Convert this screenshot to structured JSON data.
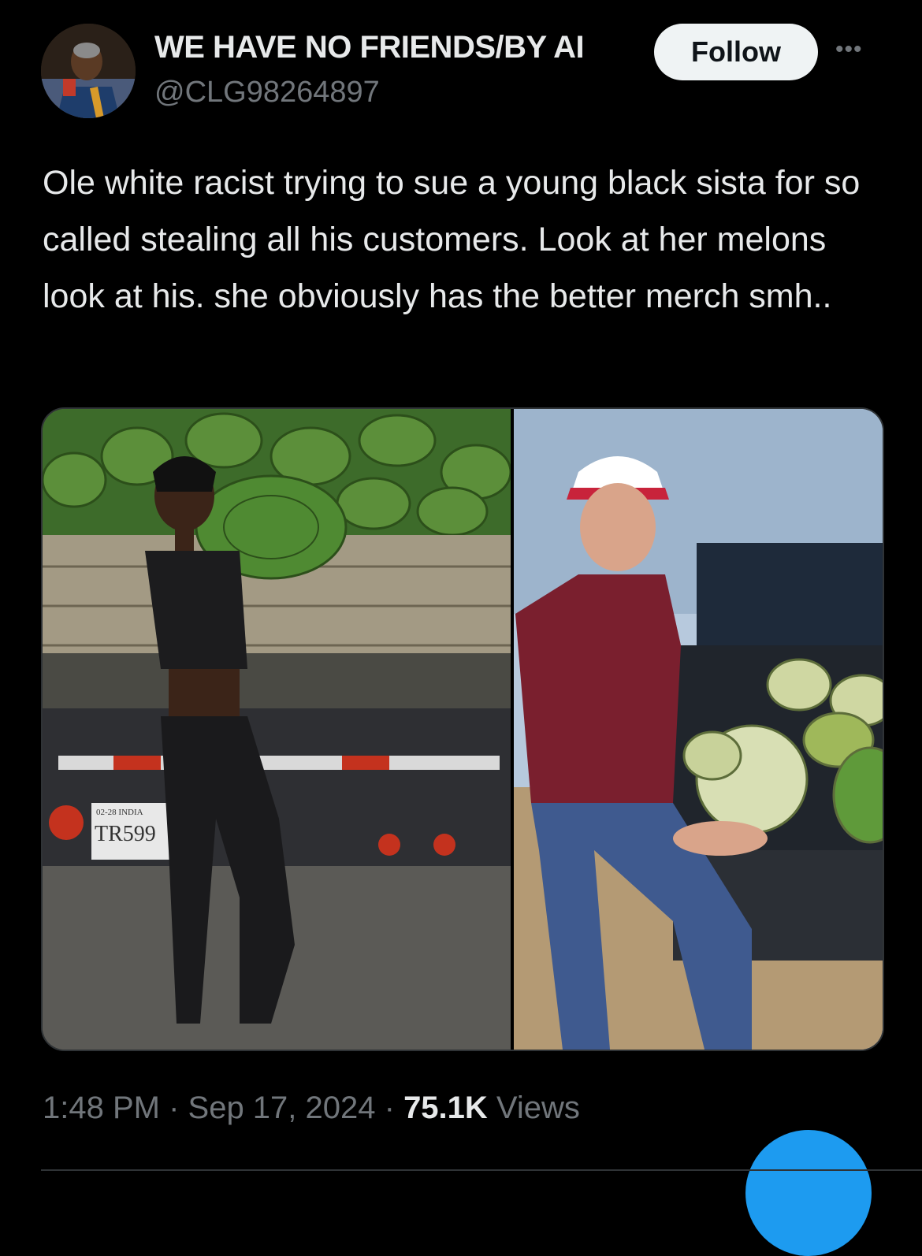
{
  "author": {
    "display_name": "WE HAVE NO FRIENDS/BY AI",
    "handle": "@CLG98264897",
    "avatar_icon": "profile-photo"
  },
  "actions": {
    "follow_label": "Follow",
    "more_label": "•••"
  },
  "tweet": {
    "text": "Ole white racist trying to sue a young black sista for so called stealing all his customers. Look at her melons look at his. she obviously has the better merch smh.."
  },
  "media": {
    "plate_line1": "02-28 INDIA",
    "plate_number": "TR599"
  },
  "meta": {
    "time": "1:48 PM",
    "separator": " · ",
    "date": "Sep 17, 2024",
    "views_count": "75.1K",
    "views_label": " Views"
  },
  "colors": {
    "background": "#000000",
    "text_primary": "#e7e9ea",
    "text_secondary": "#71767b",
    "accent": "#1d9bf0"
  }
}
